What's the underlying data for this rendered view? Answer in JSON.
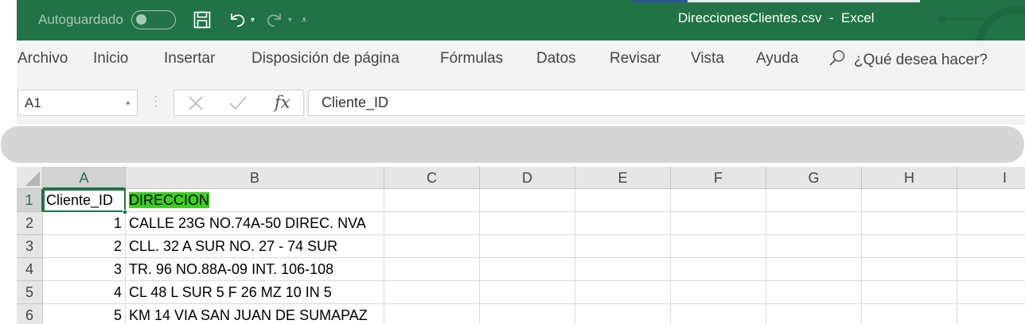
{
  "titlebar": {
    "autosave_label": "Autoguardado",
    "doc_title": "DireccionesClientes.csv  -  Excel",
    "color": "#217346",
    "icons": [
      "save-icon",
      "undo-icon",
      "redo-icon",
      "customize-qat-icon"
    ]
  },
  "menu": {
    "items": [
      {
        "label": "Archivo"
      },
      {
        "label": "Inicio"
      },
      {
        "label": "Insertar"
      },
      {
        "label": "Disposición de página"
      },
      {
        "label": "Fórmulas"
      },
      {
        "label": "Datos"
      },
      {
        "label": "Revisar"
      },
      {
        "label": "Vista"
      },
      {
        "label": "Ayuda"
      }
    ],
    "tell_me": "¿Qué desea hacer?"
  },
  "formula_bar": {
    "name_box": "A1",
    "fx_label": "fx",
    "formula": "Cliente_ID"
  },
  "grid": {
    "columns": [
      "A",
      "B",
      "C",
      "D",
      "E",
      "F",
      "G",
      "H",
      "I"
    ],
    "rows": [
      "1",
      "2",
      "3",
      "4",
      "5",
      "6"
    ],
    "selected_cell": "A1",
    "highlight_color": "#3ccf1e",
    "data": [
      {
        "a": "Cliente_ID",
        "b": "DIRECCION"
      },
      {
        "a": "1",
        "b": "CALLE 23G NO.74A-50 DIREC. NVA"
      },
      {
        "a": "2",
        "b": "CLL. 32 A SUR NO. 27 - 74 SUR"
      },
      {
        "a": "3",
        "b": "TR. 96 NO.88A-09 INT. 106-108"
      },
      {
        "a": "4",
        "b": "CL 48 L SUR 5 F 26 MZ 10 IN 5"
      },
      {
        "a": "5",
        "b": "KM 14 VIA SAN JUAN DE SUMAPAZ"
      }
    ]
  }
}
